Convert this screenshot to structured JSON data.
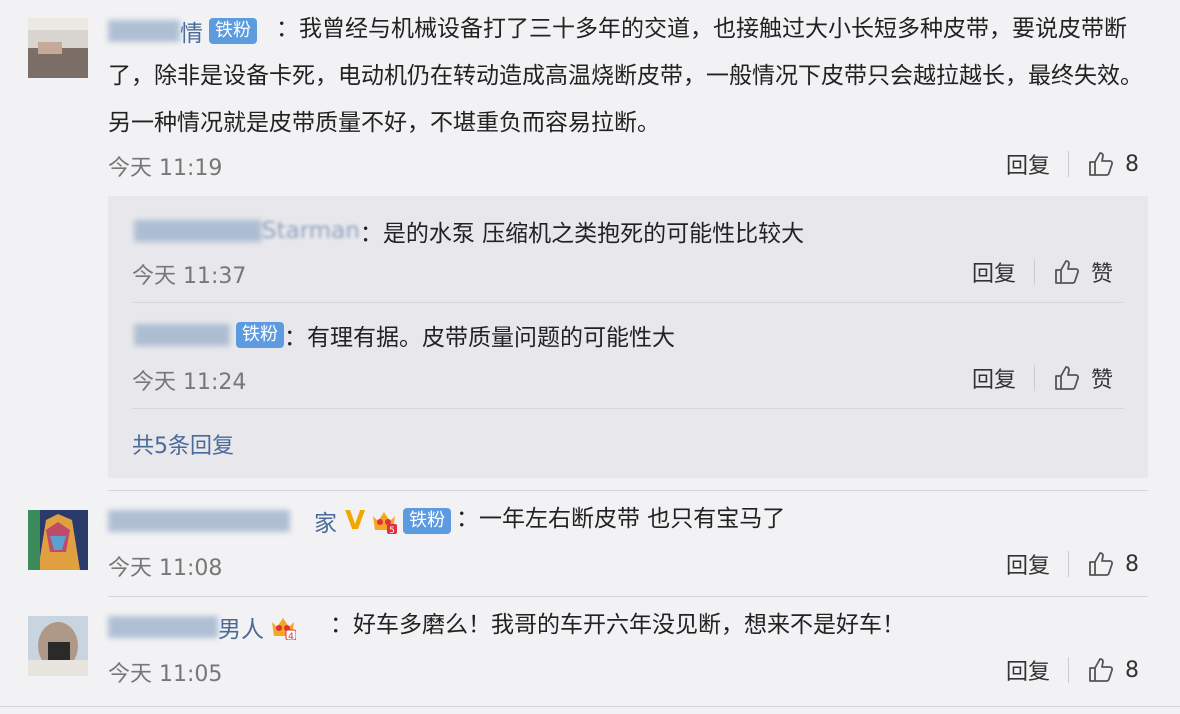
{
  "comments": [
    {
      "name_visible": "情",
      "badge": "铁粉",
      "text": "：我曾经与机械设备打了三十多年的交道，也接触过大小长短多种皮带，要说皮带断了，除非是设备卡死，电动机仍在转动造成高温烧断皮带，一般情况下皮带只会越拉越长，最终失效。另一种情况就是皮带质量不好，不堪重负而容易拉断。",
      "time": "今天 11:19",
      "reply_label": "回复",
      "likes": "8",
      "replies": [
        {
          "name_visible": "Starman",
          "text": "：是的水泵 压缩机之类抱死的可能性比较大",
          "time": "今天 11:37",
          "reply_label": "回复",
          "like_label": "赞"
        },
        {
          "name_visible": "",
          "badge": "铁粉",
          "text": "：有理有据。皮带质量问题的可能性大",
          "time": "今天 11:24",
          "reply_label": "回复",
          "like_label": "赞"
        }
      ],
      "more_replies": "共5条回复"
    },
    {
      "name_visible": "家",
      "badge": "铁粉",
      "crown_level": "5",
      "text": "：一年左右断皮带 也只有宝马了",
      "time": "今天 11:08",
      "reply_label": "回复",
      "likes": "8"
    },
    {
      "name_visible": "男人",
      "crown_level": "4",
      "text": "：好车多磨么！我哥的车开六年没见断，想来不是好车！",
      "time": "今天 11:05",
      "reply_label": "回复",
      "likes": "8"
    }
  ],
  "colors": {
    "link": "#4a6a9a",
    "badge": "#5d9be0",
    "bg": "#f2f2f4"
  },
  "icons": [
    "thumb-up-icon",
    "crown-icon",
    "verified-v-icon"
  ]
}
